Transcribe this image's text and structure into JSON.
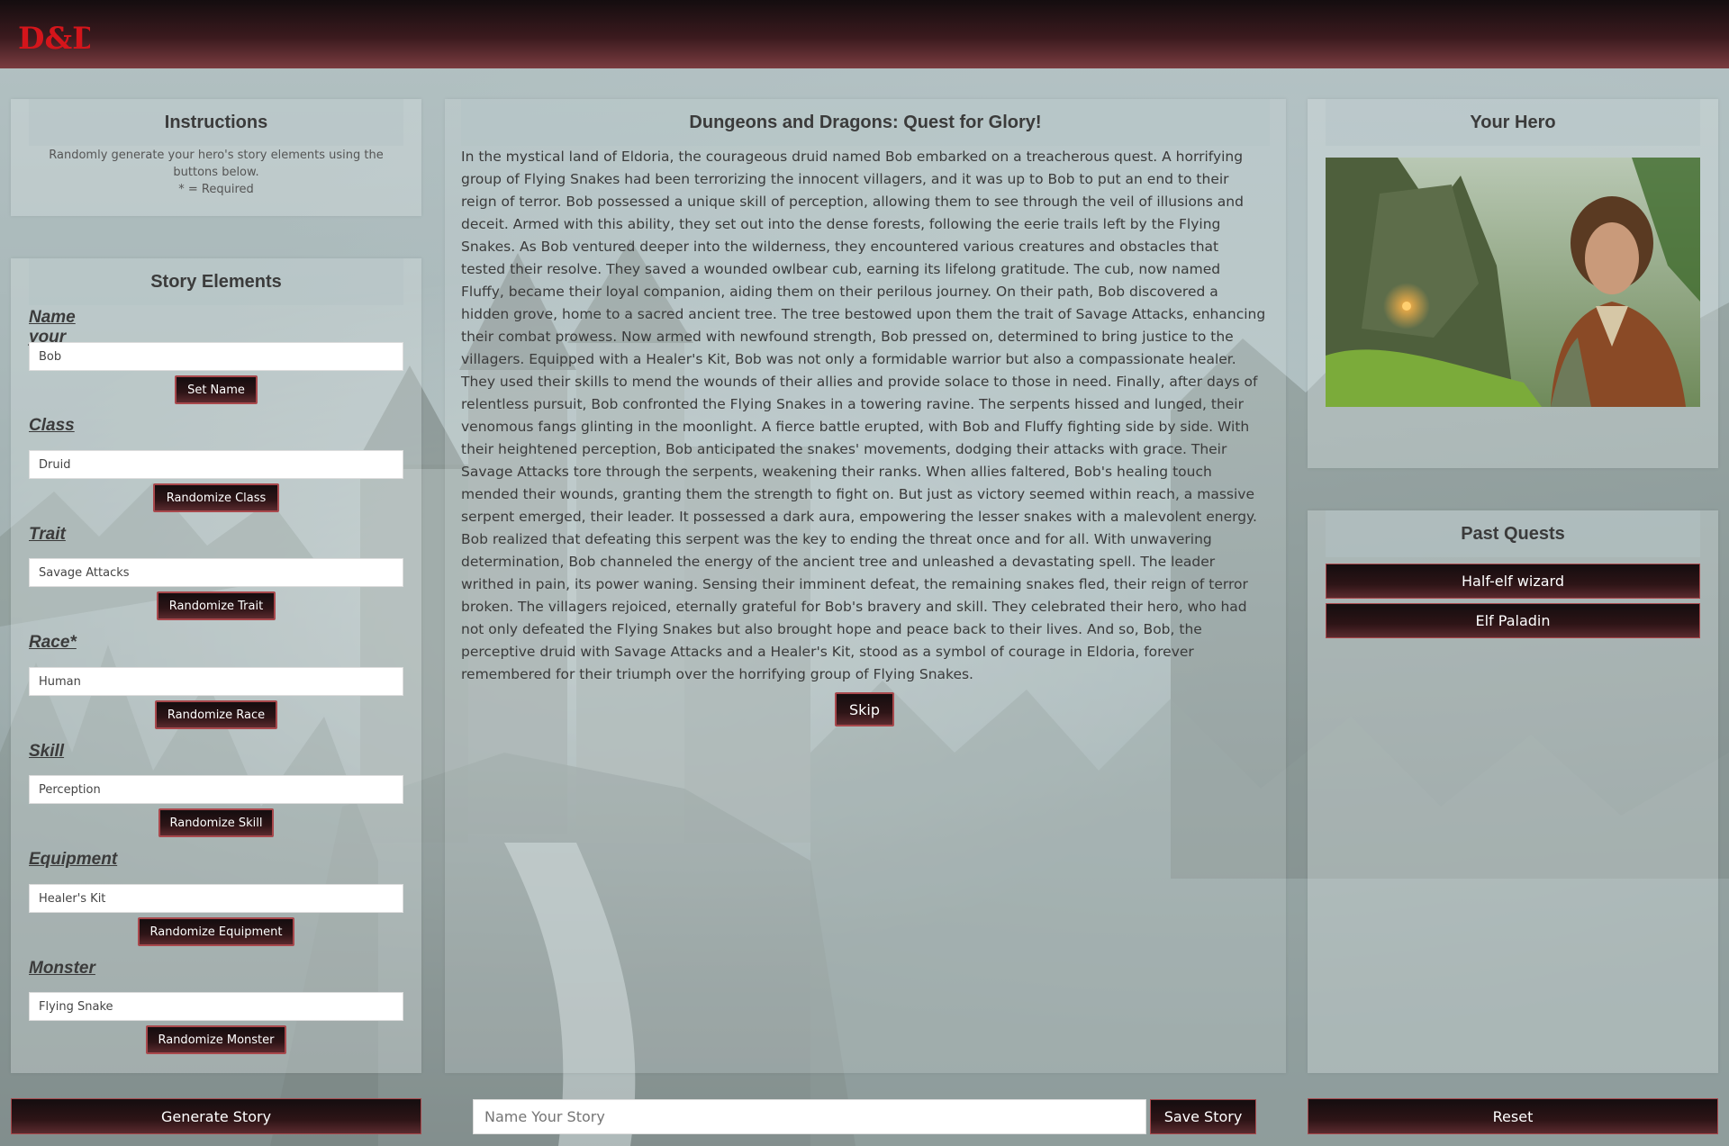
{
  "app": {
    "logo_text": "D&D"
  },
  "instructions": {
    "title": "Instructions",
    "text": "Randomly generate your hero's story elements using the buttons below.",
    "required_note": "* = Required"
  },
  "story_elements": {
    "title": "Story Elements",
    "fields": [
      {
        "label": "Name your Hero",
        "value": "Bob",
        "button": "Set Name"
      },
      {
        "label": "Class",
        "value": "Druid",
        "button": "Randomize Class"
      },
      {
        "label": "Trait",
        "value": "Savage Attacks",
        "button": "Randomize Trait"
      },
      {
        "label": "Race*",
        "value": "Human",
        "button": "Randomize Race"
      },
      {
        "label": "Skill",
        "value": "Perception",
        "button": "Randomize Skill"
      },
      {
        "label": "Equipment",
        "value": "Healer's Kit",
        "button": "Randomize Equipment"
      },
      {
        "label": "Monster",
        "value": "Flying Snake",
        "button": "Randomize Monster"
      }
    ]
  },
  "story": {
    "title": "Dungeons and Dragons: Quest for Glory!",
    "text": "In the mystical land of Eldoria, the courageous druid named Bob embarked on a treacherous quest. A horrifying group of Flying Snakes had been terrorizing the innocent villagers, and it was up to Bob to put an end to their reign of terror. Bob possessed a unique skill of perception, allowing them to see through the veil of illusions and deceit. Armed with this ability, they set out into the dense forests, following the eerie trails left by the Flying Snakes. As Bob ventured deeper into the wilderness, they encountered various creatures and obstacles that tested their resolve. They saved a wounded owlbear cub, earning its lifelong gratitude. The cub, now named Fluffy, became their loyal companion, aiding them on their perilous journey. On their path, Bob discovered a hidden grove, home to a sacred ancient tree. The tree bestowed upon them the trait of Savage Attacks, enhancing their combat prowess. Now armed with newfound strength, Bob pressed on, determined to bring justice to the villagers. Equipped with a Healer's Kit, Bob was not only a formidable warrior but also a compassionate healer. They used their skills to mend the wounds of their allies and provide solace to those in need. Finally, after days of relentless pursuit, Bob confronted the Flying Snakes in a towering ravine. The serpents hissed and lunged, their venomous fangs glinting in the moonlight. A fierce battle erupted, with Bob and Fluffy fighting side by side. With their heightened perception, Bob anticipated the snakes' movements, dodging their attacks with grace. Their Savage Attacks tore through the serpents, weakening their ranks. When allies faltered, Bob's healing touch mended their wounds, granting them the strength to fight on. But just as victory seemed within reach, a massive serpent emerged, their leader. It possessed a dark aura, empowering the lesser snakes with a malevolent energy. Bob realized that defeating this serpent was the key to ending the threat once and for all. With unwavering determination, Bob channeled the energy of the ancient tree and unleashed a devastating spell. The leader writhed in pain, its power waning. Sensing their imminent defeat, the remaining snakes fled, their reign of terror broken. The villagers rejoiced, eternally grateful for Bob's bravery and skill. They celebrated their hero, who had not only defeated the Flying Snakes but also brought hope and peace back to their lives. And so, Bob, the perceptive druid with Savage Attacks and a Healer's Kit, stood as a symbol of courage in Eldoria, forever remembered for their triumph over the horrifying group of Flying Snakes.",
    "skip_label": "Skip"
  },
  "hero": {
    "title": "Your Hero"
  },
  "past_quests": {
    "title": "Past Quests",
    "items": [
      "Half-elf wizard",
      "Elf Paladin"
    ]
  },
  "footer": {
    "generate_label": "Generate Story",
    "story_name_placeholder": "Name Your Story",
    "save_label": "Save Story",
    "reset_label": "Reset"
  },
  "colors": {
    "brand_red": "#d4151b",
    "button_dark": "#140d0f",
    "button_border": "#a8484c"
  }
}
